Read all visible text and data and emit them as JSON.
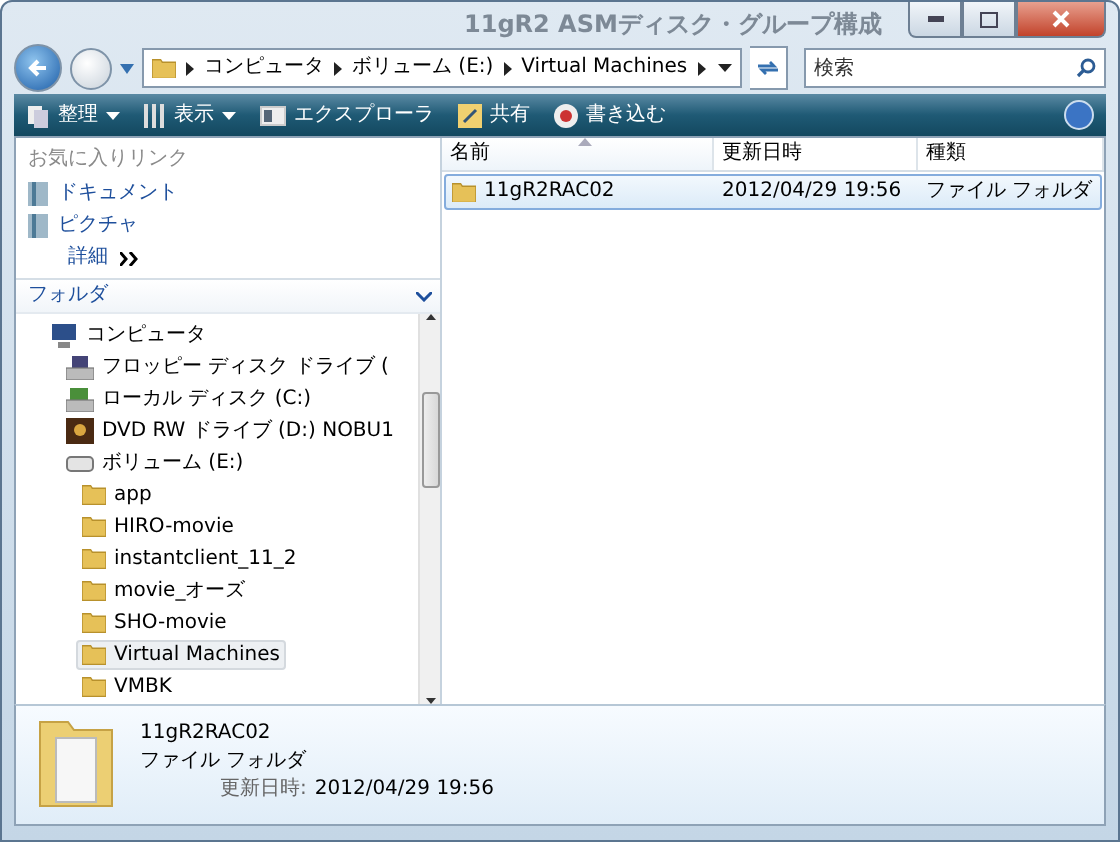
{
  "window": {
    "background_text": "11gR2 ASMディスク・グループ構成"
  },
  "navigation": {
    "breadcrumbs": [
      "コンピュータ",
      "ボリューム (E:)",
      "Virtual Machines"
    ],
    "search": {
      "placeholder": "検索"
    }
  },
  "toolbar": [
    {
      "label": "整理",
      "kind": "menu"
    },
    {
      "label": "表示",
      "kind": "menu"
    },
    {
      "label": "エクスプローラ",
      "kind": "explorer"
    },
    {
      "label": "共有",
      "kind": "share"
    },
    {
      "label": "書き込む",
      "kind": "burn"
    }
  ],
  "favorites": {
    "title": "お気に入りリンク",
    "items": [
      {
        "label": "ドキュメント"
      },
      {
        "label": "ピクチャ"
      }
    ],
    "more": "詳細"
  },
  "folders": {
    "title": "フォルダ",
    "tree": [
      {
        "label": "コンピュータ",
        "kind": "computer",
        "selected": false,
        "children": [
          {
            "label": "フロッピー ディスク ドライブ (",
            "kind": "floppy",
            "selected": false
          },
          {
            "label": "ローカル ディスク (C:)",
            "kind": "disk",
            "selected": false
          },
          {
            "label": "DVD RW ドライブ (D:) NOBU1",
            "kind": "dvd",
            "selected": false
          },
          {
            "label": "ボリューム (E:)",
            "kind": "drive",
            "selected": false,
            "children": [
              {
                "label": "app",
                "kind": "folder",
                "selected": false
              },
              {
                "label": "HIRO-movie",
                "kind": "folder",
                "selected": false
              },
              {
                "label": "instantclient_11_2",
                "kind": "folder",
                "selected": false
              },
              {
                "label": "movie_オーズ",
                "kind": "folder",
                "selected": false
              },
              {
                "label": "SHO-movie",
                "kind": "folder",
                "selected": false
              },
              {
                "label": "Virtual Machines",
                "kind": "folder",
                "selected": true
              },
              {
                "label": "VMBK",
                "kind": "folder",
                "selected": false
              }
            ]
          }
        ]
      }
    ]
  },
  "file_list": {
    "columns": [
      {
        "label": "名前",
        "sorted": true
      },
      {
        "label": "更新日時",
        "sorted": false
      },
      {
        "label": "種類",
        "sorted": false
      }
    ],
    "rows": [
      {
        "name": "11gR2RAC02",
        "modified": "2012/04/29 19:56",
        "type": "ファイル フォルダ",
        "selected": true
      }
    ]
  },
  "details": {
    "name": "11gR2RAC02",
    "type": "ファイル フォルダ",
    "field_label": "更新日時:",
    "field_value": "2012/04/29 19:56"
  }
}
